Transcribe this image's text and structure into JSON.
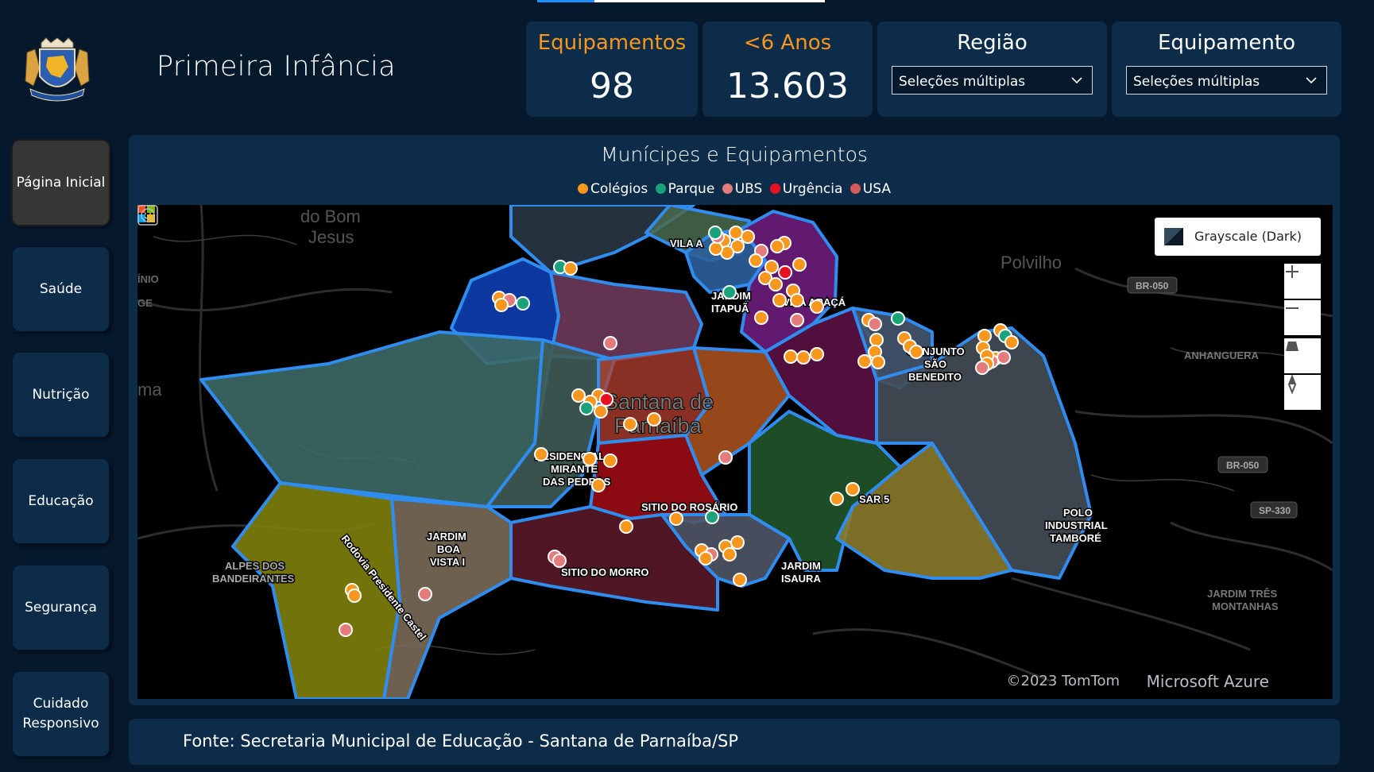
{
  "header": {
    "title": "Primeira Infância"
  },
  "kpis": [
    {
      "label": "Equipamentos",
      "value": "98"
    },
    {
      "label": "<6 Anos",
      "value": "13.603"
    }
  ],
  "filters": [
    {
      "label": "Região",
      "selected": "Seleções múltiplas"
    },
    {
      "label": "Equipamento",
      "selected": "Seleções múltiplas"
    }
  ],
  "nav": {
    "items": [
      {
        "label": "Página Inicial",
        "active": true
      },
      {
        "label": "Saúde"
      },
      {
        "label": "Nutrição"
      },
      {
        "label": "Educação"
      },
      {
        "label": "Segurança"
      },
      {
        "label": "Cuidado Responsivo"
      }
    ]
  },
  "map": {
    "title": "Munícipes e Equipamentos",
    "legend": [
      {
        "label": "Colégios",
        "color": "#f7971d"
      },
      {
        "label": "Parque",
        "color": "#1aa37a"
      },
      {
        "label": "UBS",
        "color": "#e47c7c"
      },
      {
        "label": "Urgência",
        "color": "#e81123"
      },
      {
        "label": "USA",
        "color": "#d65a5a"
      }
    ],
    "style_picker": "Grayscale (Dark)",
    "place_labels": {
      "do_bom_jesus_1": "do Bom",
      "do_bom_jesus_2": "Jesus",
      "polvilho": "Polvilho",
      "inio": "ÍNIO",
      "ge": "GE",
      "ma": "ma",
      "vila_a": "VILA A",
      "jardim_itapua_1": "JARDIM",
      "jardim_itapua_2": "ITAPUÃ",
      "vila_araca": "VILA ARAÇÁ",
      "conjunto_1": "CONJUNTO",
      "conjunto_2": "SÃO",
      "conjunto_3": "BENEDITO",
      "anhanguera": "ANHANGUERA",
      "santana_1": "Santana de",
      "santana_2": "Parnaíba",
      "residencial_1": "RESIDENCIAL",
      "residencial_2": "MIRANTE",
      "residencial_3": "DAS PEDRAS",
      "sitio_rosario": "SITIO DO ROSÁRIO",
      "sar5": "SAR 5",
      "polo_1": "POLO",
      "polo_2": "INDUSTRIAL",
      "polo_3": "TAMBORÉ",
      "jardim_boa_vista_1": "JARDIM",
      "jardim_boa_vista_2": "BOA",
      "jardim_boa_vista_3": "VISTA I",
      "sitio_morro": "SITIO DO MORRO",
      "jardim_isaura_1": "JARDIM",
      "jardim_isaura_2": "ISAURA",
      "alpes_1": "ALPES DOS",
      "alpes_2": "BANDEIRANTES",
      "rodovia": "Rodovia Presidente Castel",
      "jardim_tres_1": "JARDIM TRÊS",
      "jardim_tres_2": "MONTANHAS"
    },
    "road_shields": {
      "br050_a": "BR-050",
      "br050_b": "BR-050",
      "sp330": "SP-330"
    },
    "copyright": "©2023 TomTom",
    "brand": "Microsoft Azure"
  },
  "footer": {
    "source": "Fonte: Secretaria Municipal de Educação - Santana de Parnaíba/SP"
  }
}
